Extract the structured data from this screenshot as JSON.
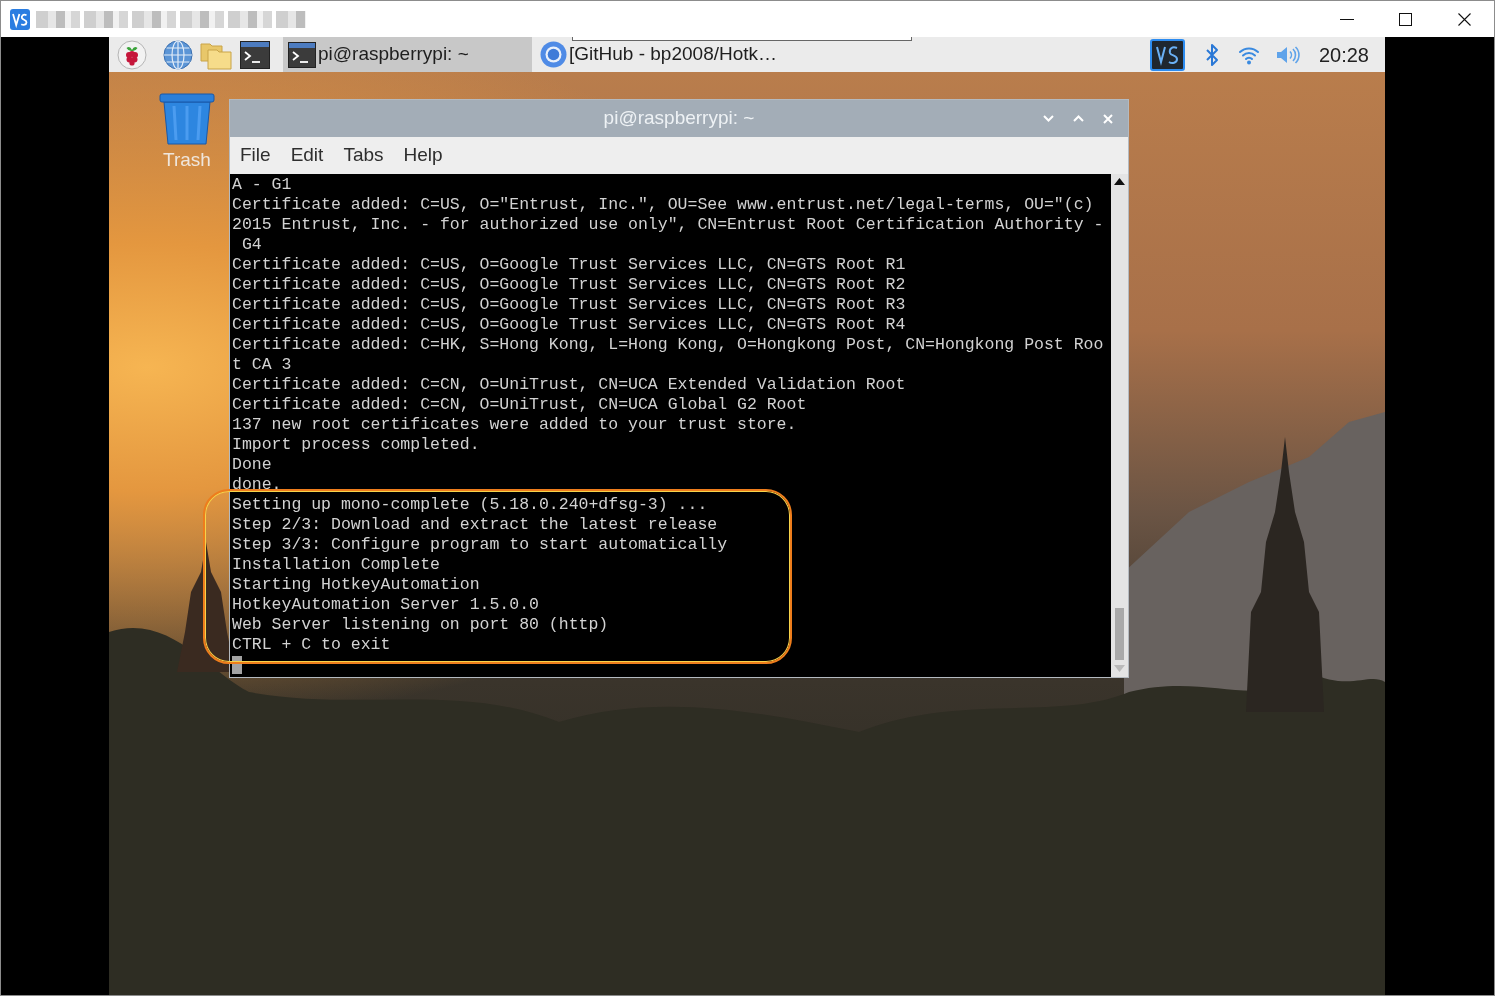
{
  "taskbar": {
    "tasks": [
      {
        "label": "pi@raspberrypi: ~",
        "kind": "terminal",
        "selected": true
      },
      {
        "label": "[GitHub - bp2008/Hotk…",
        "kind": "browser",
        "selected": false
      }
    ],
    "clock": "20:28"
  },
  "desktop": {
    "icons": [
      {
        "label": "Trash",
        "kind": "trash"
      }
    ]
  },
  "terminal_window": {
    "title": "pi@raspberrypi: ~",
    "menu": [
      "File",
      "Edit",
      "Tabs",
      "Help"
    ],
    "lines": [
      "A - G1",
      "Certificate added: C=US, O=\"Entrust, Inc.\", OU=See www.entrust.net/legal-terms, OU=\"(c)",
      "2015 Entrust, Inc. - for authorized use only\", CN=Entrust Root Certification Authority -",
      " G4",
      "Certificate added: C=US, O=Google Trust Services LLC, CN=GTS Root R1",
      "Certificate added: C=US, O=Google Trust Services LLC, CN=GTS Root R2",
      "Certificate added: C=US, O=Google Trust Services LLC, CN=GTS Root R3",
      "Certificate added: C=US, O=Google Trust Services LLC, CN=GTS Root R4",
      "Certificate added: C=HK, S=Hong Kong, L=Hong Kong, O=Hongkong Post, CN=Hongkong Post Roo",
      "t CA 3",
      "Certificate added: C=CN, O=UniTrust, CN=UCA Extended Validation Root",
      "Certificate added: C=CN, O=UniTrust, CN=UCA Global G2 Root",
      "137 new root certificates were added to your trust store.",
      "Import process completed.",
      "Done",
      "done."
    ],
    "highlighted_lines": [
      "Setting up mono-complete (5.18.0.240+dfsg-3) ...",
      "Step 2/3: Download and extract the latest release",
      "Step 3/3: Configure program to start automatically",
      "Installation Complete",
      "Starting HotkeyAutomation",
      "HotkeyAutomation Server 1.5.0.0",
      "Web Server listening on port 80 (http)",
      "CTRL + C to exit"
    ]
  }
}
